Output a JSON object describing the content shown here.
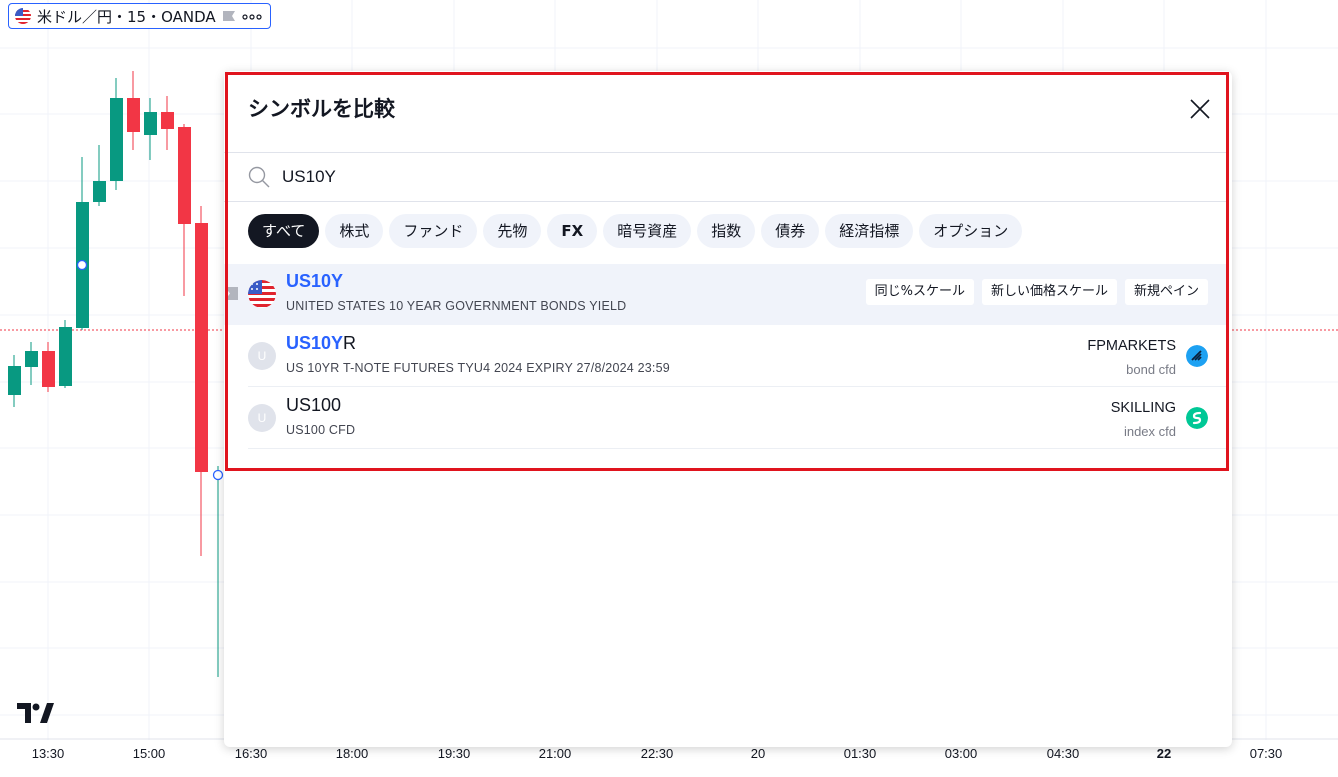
{
  "symbol_pill": {
    "label": "米ドル／円・15・OANDA",
    "icons": [
      "us-flag-icon",
      "flag-marker-icon",
      "more-dots-icon"
    ]
  },
  "time_axis": [
    "13:30",
    "15:00",
    "16:30",
    "18:00",
    "19:30",
    "21:00",
    "22:30",
    "20",
    "01:30",
    "03:00",
    "04:30",
    "22",
    "07:30"
  ],
  "dialog": {
    "title": "シンボルを比較",
    "close_icon": "close-icon",
    "search": {
      "value": "US10Y",
      "icon": "search-icon"
    },
    "filters": [
      "すべて",
      "株式",
      "ファンド",
      "先物",
      "FX",
      "暗号資産",
      "指数",
      "債券",
      "経済指標",
      "オプション"
    ],
    "results": [
      {
        "match": "US10Y",
        "rest": "",
        "description": "UNITED STATES 10 YEAR GOVERNMENT BONDS YIELD",
        "avatar": "us-flag-icon",
        "actions": [
          "同じ%スケール",
          "新しい価格スケール",
          "新規ペイン"
        ]
      },
      {
        "match": "US10Y",
        "rest": "R",
        "description": "US 10YR T-NOTE FUTURES TYU4 2024 EXPIRY 27/8/2024 23:59",
        "avatar_letter": "U",
        "exchange": "FPMARKETS",
        "type": "bond cfd",
        "exchange_icon": "fpmarkets-logo-icon"
      },
      {
        "match": "",
        "rest": "US100",
        "description": "US100 CFD",
        "avatar_letter": "U",
        "exchange": "SKILLING",
        "type": "index cfd",
        "exchange_icon": "skilling-logo-icon"
      }
    ]
  },
  "colors": {
    "up": "#089981",
    "down": "#f23645",
    "accent": "#2962ff",
    "highlight": "#e0141e"
  }
}
